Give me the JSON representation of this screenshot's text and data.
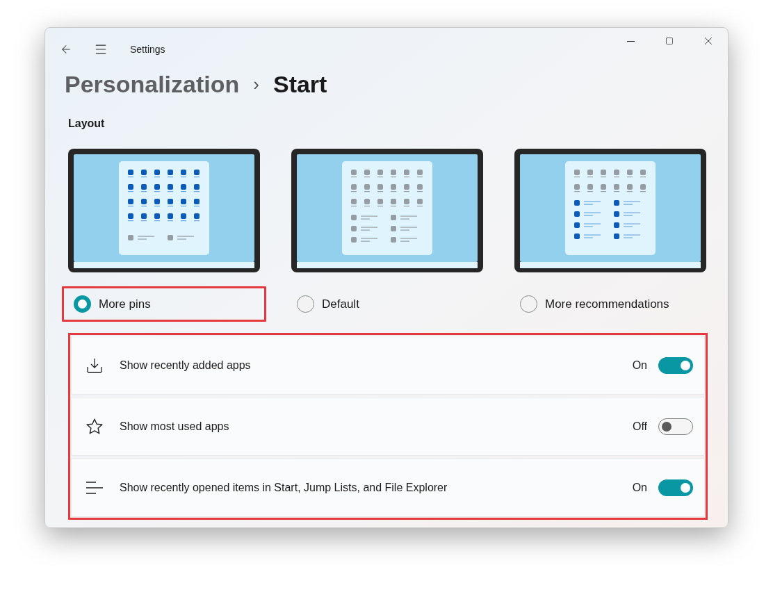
{
  "window": {
    "title": "Settings"
  },
  "breadcrumb": {
    "parent": "Personalization",
    "separator": "›",
    "current": "Start"
  },
  "section_title": "Layout",
  "layouts": [
    {
      "label": "More pins",
      "kind": "more_pins",
      "selected": true,
      "highlighted": true
    },
    {
      "label": "Default",
      "kind": "default",
      "selected": false,
      "highlighted": false
    },
    {
      "label": "More recommendations",
      "kind": "more_recommendations",
      "selected": false,
      "highlighted": false
    }
  ],
  "settings_group": {
    "highlighted": true,
    "items": [
      {
        "label": "Show recently added apps",
        "state_label": "On",
        "on": true
      },
      {
        "label": "Show most used apps",
        "state_label": "Off",
        "on": false
      },
      {
        "label": "Show recently opened items in Start, Jump Lists, and File Explorer",
        "state_label": "On",
        "on": true
      }
    ]
  }
}
